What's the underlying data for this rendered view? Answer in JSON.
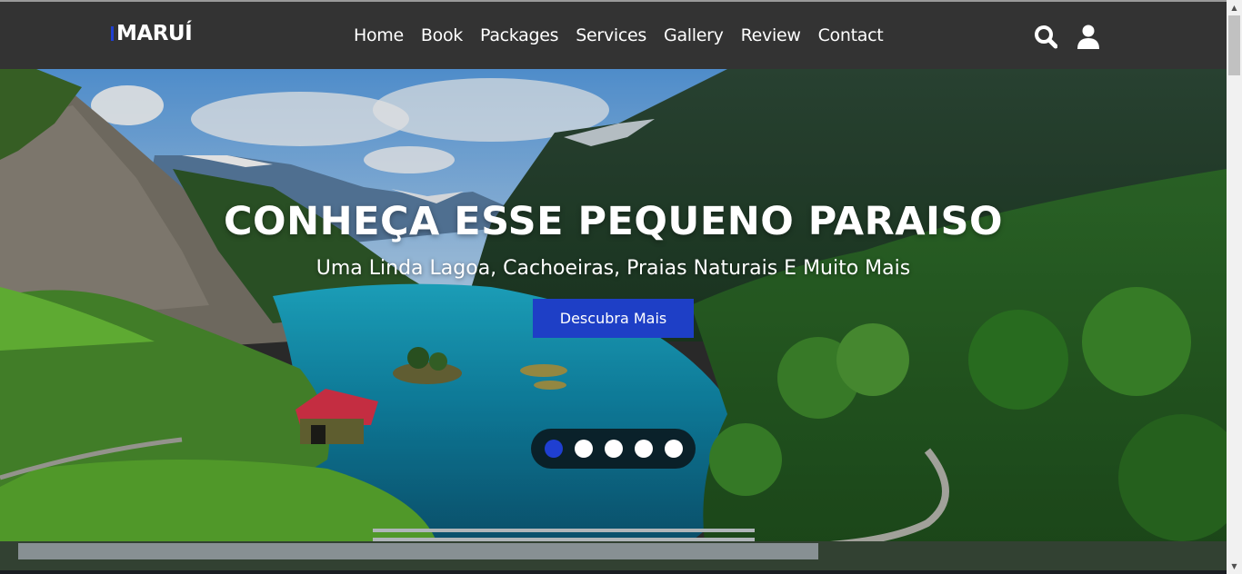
{
  "header": {
    "logo": "MARUÍ",
    "nav": [
      "Home",
      "Book",
      "Packages",
      "Services",
      "Gallery",
      "Review",
      "Contact"
    ],
    "icons": {
      "search": "search-icon",
      "user": "user-icon"
    }
  },
  "hero": {
    "title": "CONHEÇA ESSE PEQUENO PARAISO",
    "subtitle": "Uma Linda Lagoa, Cachoeiras, Praias Naturais E Muito Mais",
    "cta_label": "Descubra Mais",
    "slides": {
      "count": 5,
      "active": 1
    }
  },
  "colors": {
    "header_bg": "#333333",
    "accent": "#1e3fc6",
    "text": "#ffffff"
  }
}
